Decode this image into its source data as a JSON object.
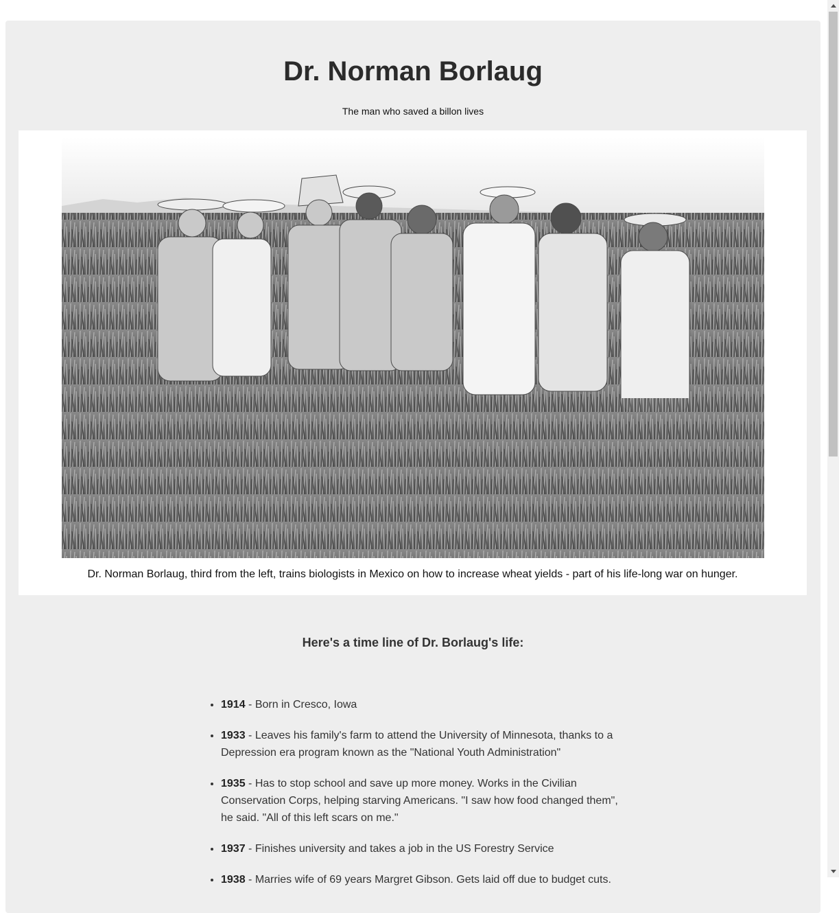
{
  "title": "Dr. Norman Borlaug",
  "subtitle": "The man who saved a billon lives",
  "image": {
    "alt": "Dr. Norman Borlaug, third from the left, trains biologists in Mexico on how to increase wheat yields - part of his life-long war on hunger.",
    "caption": "Dr. Norman Borlaug, third from the left, trains biologists in Mexico on how to increase wheat yields - part of his life-long war on hunger."
  },
  "timeline": {
    "headline": "Here's a time line of Dr. Borlaug's life:",
    "items": [
      {
        "year": "1914",
        "text": " - Born in Cresco, Iowa"
      },
      {
        "year": "1933",
        "text": " - Leaves his family's farm to attend the University of Minnesota, thanks to a Depression era program known as the \"National Youth Administration\""
      },
      {
        "year": "1935",
        "text": " - Has to stop school and save up more money. Works in the Civilian Conservation Corps, helping starving Americans. \"I saw how food changed them\", he said. \"All of this left scars on me.\""
      },
      {
        "year": "1937",
        "text": " - Finishes university and takes a job in the US Forestry Service"
      },
      {
        "year": "1938",
        "text": " - Marries wife of 69 years Margret Gibson. Gets laid off due to budget cuts."
      }
    ]
  },
  "colors": {
    "page_background": "#eeeeee",
    "image_panel": "#ffffff",
    "title_text": "#2b2b2b"
  }
}
